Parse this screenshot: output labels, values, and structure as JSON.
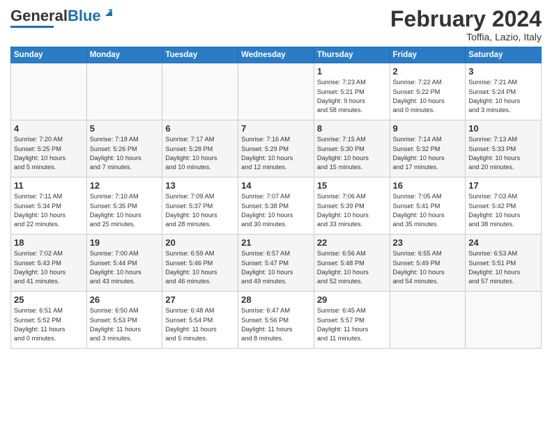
{
  "header": {
    "logo_general": "General",
    "logo_blue": "Blue",
    "month_title": "February 2024",
    "location": "Toffia, Lazio, Italy"
  },
  "weekdays": [
    "Sunday",
    "Monday",
    "Tuesday",
    "Wednesday",
    "Thursday",
    "Friday",
    "Saturday"
  ],
  "weeks": [
    [
      {
        "day": "",
        "info": ""
      },
      {
        "day": "",
        "info": ""
      },
      {
        "day": "",
        "info": ""
      },
      {
        "day": "",
        "info": ""
      },
      {
        "day": "1",
        "info": "Sunrise: 7:23 AM\nSunset: 5:21 PM\nDaylight: 9 hours\nand 58 minutes."
      },
      {
        "day": "2",
        "info": "Sunrise: 7:22 AM\nSunset: 5:22 PM\nDaylight: 10 hours\nand 0 minutes."
      },
      {
        "day": "3",
        "info": "Sunrise: 7:21 AM\nSunset: 5:24 PM\nDaylight: 10 hours\nand 3 minutes."
      }
    ],
    [
      {
        "day": "4",
        "info": "Sunrise: 7:20 AM\nSunset: 5:25 PM\nDaylight: 10 hours\nand 5 minutes."
      },
      {
        "day": "5",
        "info": "Sunrise: 7:18 AM\nSunset: 5:26 PM\nDaylight: 10 hours\nand 7 minutes."
      },
      {
        "day": "6",
        "info": "Sunrise: 7:17 AM\nSunset: 5:28 PM\nDaylight: 10 hours\nand 10 minutes."
      },
      {
        "day": "7",
        "info": "Sunrise: 7:16 AM\nSunset: 5:29 PM\nDaylight: 10 hours\nand 12 minutes."
      },
      {
        "day": "8",
        "info": "Sunrise: 7:15 AM\nSunset: 5:30 PM\nDaylight: 10 hours\nand 15 minutes."
      },
      {
        "day": "9",
        "info": "Sunrise: 7:14 AM\nSunset: 5:32 PM\nDaylight: 10 hours\nand 17 minutes."
      },
      {
        "day": "10",
        "info": "Sunrise: 7:13 AM\nSunset: 5:33 PM\nDaylight: 10 hours\nand 20 minutes."
      }
    ],
    [
      {
        "day": "11",
        "info": "Sunrise: 7:11 AM\nSunset: 5:34 PM\nDaylight: 10 hours\nand 22 minutes."
      },
      {
        "day": "12",
        "info": "Sunrise: 7:10 AM\nSunset: 5:35 PM\nDaylight: 10 hours\nand 25 minutes."
      },
      {
        "day": "13",
        "info": "Sunrise: 7:09 AM\nSunset: 5:37 PM\nDaylight: 10 hours\nand 28 minutes."
      },
      {
        "day": "14",
        "info": "Sunrise: 7:07 AM\nSunset: 5:38 PM\nDaylight: 10 hours\nand 30 minutes."
      },
      {
        "day": "15",
        "info": "Sunrise: 7:06 AM\nSunset: 5:39 PM\nDaylight: 10 hours\nand 33 minutes."
      },
      {
        "day": "16",
        "info": "Sunrise: 7:05 AM\nSunset: 5:41 PM\nDaylight: 10 hours\nand 35 minutes."
      },
      {
        "day": "17",
        "info": "Sunrise: 7:03 AM\nSunset: 5:42 PM\nDaylight: 10 hours\nand 38 minutes."
      }
    ],
    [
      {
        "day": "18",
        "info": "Sunrise: 7:02 AM\nSunset: 5:43 PM\nDaylight: 10 hours\nand 41 minutes."
      },
      {
        "day": "19",
        "info": "Sunrise: 7:00 AM\nSunset: 5:44 PM\nDaylight: 10 hours\nand 43 minutes."
      },
      {
        "day": "20",
        "info": "Sunrise: 6:59 AM\nSunset: 5:46 PM\nDaylight: 10 hours\nand 46 minutes."
      },
      {
        "day": "21",
        "info": "Sunrise: 6:57 AM\nSunset: 5:47 PM\nDaylight: 10 hours\nand 49 minutes."
      },
      {
        "day": "22",
        "info": "Sunrise: 6:56 AM\nSunset: 5:48 PM\nDaylight: 10 hours\nand 52 minutes."
      },
      {
        "day": "23",
        "info": "Sunrise: 6:55 AM\nSunset: 5:49 PM\nDaylight: 10 hours\nand 54 minutes."
      },
      {
        "day": "24",
        "info": "Sunrise: 6:53 AM\nSunset: 5:51 PM\nDaylight: 10 hours\nand 57 minutes."
      }
    ],
    [
      {
        "day": "25",
        "info": "Sunrise: 6:51 AM\nSunset: 5:52 PM\nDaylight: 11 hours\nand 0 minutes."
      },
      {
        "day": "26",
        "info": "Sunrise: 6:50 AM\nSunset: 5:53 PM\nDaylight: 11 hours\nand 3 minutes."
      },
      {
        "day": "27",
        "info": "Sunrise: 6:48 AM\nSunset: 5:54 PM\nDaylight: 11 hours\nand 5 minutes."
      },
      {
        "day": "28",
        "info": "Sunrise: 6:47 AM\nSunset: 5:56 PM\nDaylight: 11 hours\nand 8 minutes."
      },
      {
        "day": "29",
        "info": "Sunrise: 6:45 AM\nSunset: 5:57 PM\nDaylight: 11 hours\nand 11 minutes."
      },
      {
        "day": "",
        "info": ""
      },
      {
        "day": "",
        "info": ""
      }
    ]
  ]
}
